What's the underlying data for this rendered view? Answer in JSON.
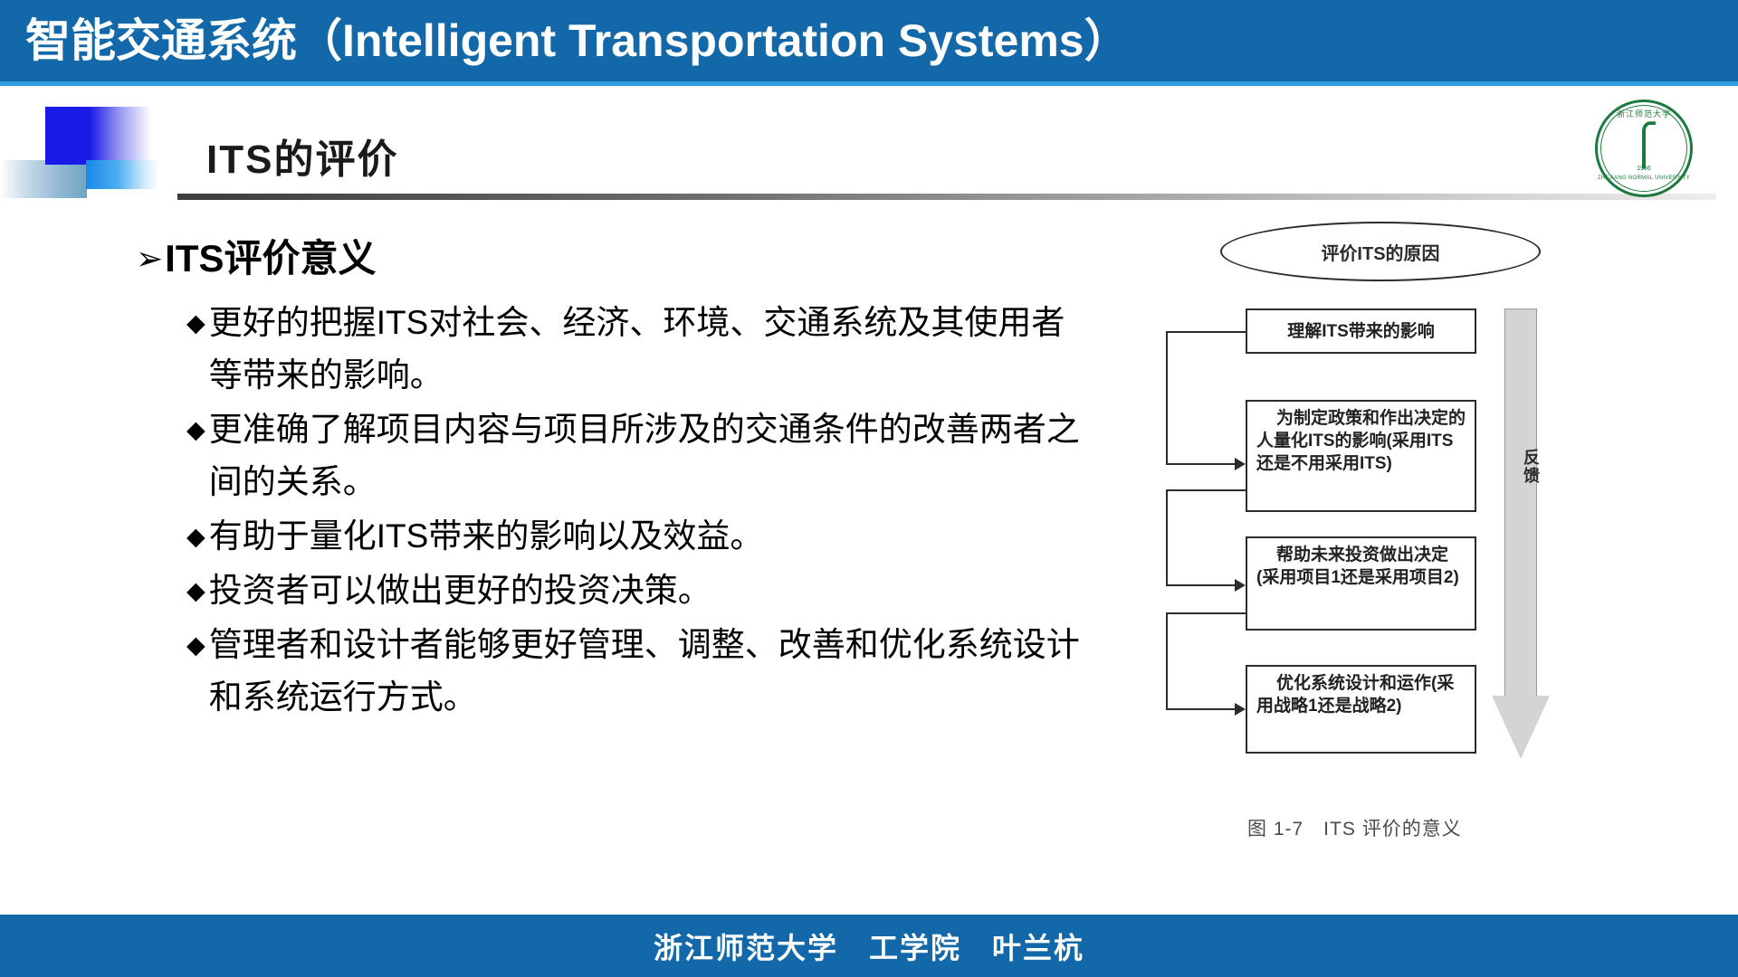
{
  "header": {
    "title_cn": "智能交通系统",
    "title_en": "（Intelligent Transportation Systems）",
    "bar_color": "#1268a8",
    "underline_color": "#2b9fe0"
  },
  "slide": {
    "title": "ITS的评价"
  },
  "content": {
    "level1": {
      "marker": "➢",
      "text": "ITS评价意义"
    },
    "bullets": [
      {
        "marker": "◆",
        "text": "更好的把握ITS对社会、经济、环境、交通系统及其使用者等带来的影响。"
      },
      {
        "marker": "◆",
        "text": "更准确了解项目内容与项目所涉及的交通条件的改善两者之间的关系。"
      },
      {
        "marker": "◆",
        "text": "有助于量化ITS带来的影响以及效益。"
      },
      {
        "marker": "◆",
        "text": "投资者可以做出更好的投资决策。"
      },
      {
        "marker": "◆",
        "text": "管理者和设计者能够更好管理、调整、改善和优化系统设计和系统运行方式。"
      }
    ]
  },
  "figure": {
    "ellipse_label": "评价ITS的原因",
    "boxes": [
      "理解ITS带来的影响",
      "为制定政策和作出决定的人量化ITS的影响(采用ITS还是不用采用ITS)",
      "帮助未来投资做出决定(采用项目1还是采用项目2)",
      "优化系统设计和运作(采用战略1还是战略2)"
    ],
    "feedback_label": "反馈",
    "caption": "图 1-7　ITS 评价的意义"
  },
  "logo": {
    "name_cn": "浙江师范大学",
    "name_en": "ZHEJIANG NORMAL UNIVERSITY",
    "year": "1956",
    "color": "#1c7a3e"
  },
  "footer": {
    "text": "浙江师范大学　工学院　叶兰杭",
    "bar_color": "#1268a8"
  }
}
